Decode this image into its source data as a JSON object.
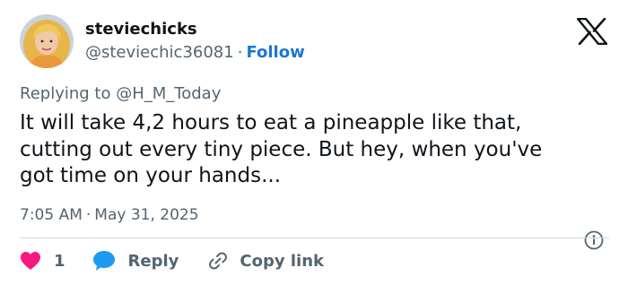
{
  "author": {
    "display_name": "steviechicks",
    "handle": "@steviechic36081",
    "separator": "·",
    "follow_label": "Follow"
  },
  "replying": {
    "prefix": "Replying to",
    "mention": "@H_M_Today"
  },
  "tweet": {
    "line1": "It will take 4,2 hours to eat a pineapple like that,",
    "line2": "cutting out every tiny piece. But hey, when you've",
    "line3": "got time on your hands..."
  },
  "meta": {
    "time": "7:05 AM",
    "separator": "·",
    "date": "May 31, 2025"
  },
  "actions": {
    "like_count": "1",
    "reply_label": "Reply",
    "copy_label": "Copy link"
  },
  "icons": {
    "avatar": "avatar-photo",
    "platform_logo": "x-logo-icon",
    "info": "info-icon",
    "like": "heart-icon",
    "reply": "speech-bubble-icon",
    "copy": "link-icon"
  },
  "colors": {
    "link": "#1d76d2",
    "text": "#0f1419",
    "secondary": "#536471",
    "like": "#f91880",
    "reply": "#1d9bf0",
    "divider": "#cfd9de"
  }
}
